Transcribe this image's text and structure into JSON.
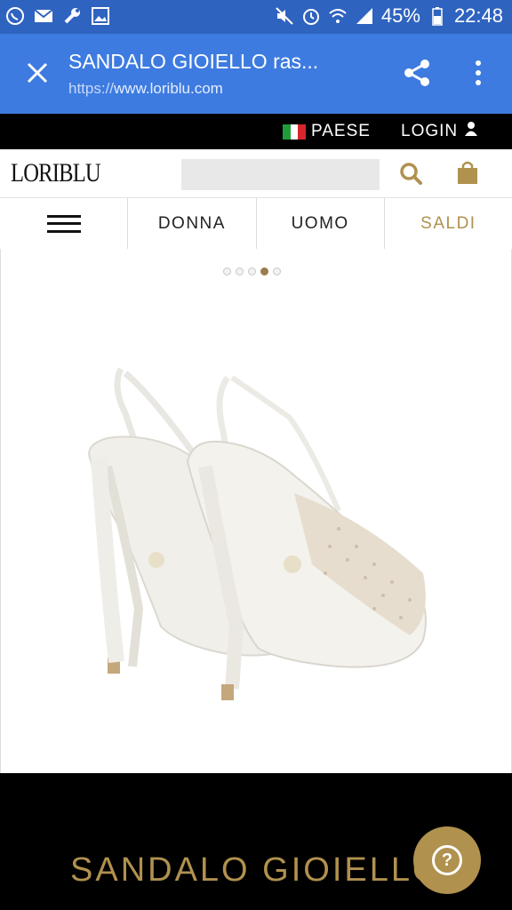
{
  "status_bar": {
    "battery": "45%",
    "time": "22:48",
    "left_icons": [
      "whatsapp-icon",
      "mail-icon",
      "wrench-icon",
      "image-icon"
    ],
    "right_icons": [
      "mute-icon",
      "alarm-icon",
      "wifi-icon",
      "signal-icon",
      "battery-icon"
    ]
  },
  "browser": {
    "tab_title": "SANDALO GIOIELLO ras...",
    "url_protocol": "https://",
    "url_host": "www.loriblu.com"
  },
  "top_bar": {
    "country_label": "PAESE",
    "login_label": "LOGIN"
  },
  "header": {
    "logo": "LORIBLU",
    "search_placeholder": ""
  },
  "nav": {
    "items": [
      {
        "label": ""
      },
      {
        "label": "DONNA"
      },
      {
        "label": "UOMO"
      },
      {
        "label": "SALDI"
      }
    ]
  },
  "carousel": {
    "total": 5,
    "active_index": 3
  },
  "product": {
    "title": "SANDALO GIOIELLO"
  },
  "help": {
    "label": "?"
  },
  "colors": {
    "status_bar": "#2f63c0",
    "browser_bar": "#3d7be0",
    "gold": "#b0914e",
    "black": "#000000"
  }
}
